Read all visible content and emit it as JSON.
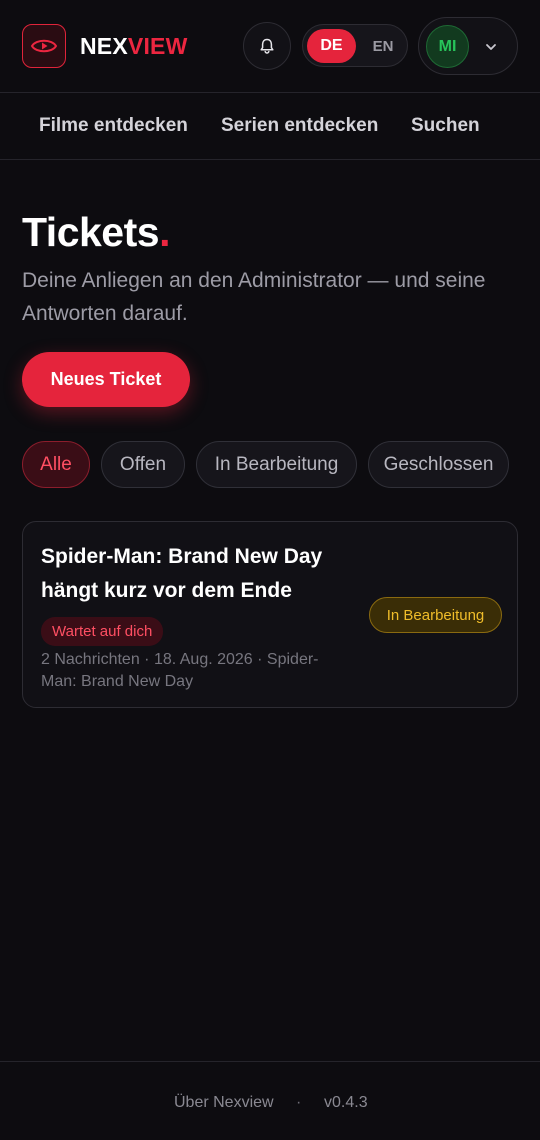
{
  "header": {
    "brand_part1": "NEX",
    "brand_part2": "VIEW",
    "logo_icon": "eye-play-icon",
    "notifications_icon": "bell-icon",
    "language": {
      "options": [
        "DE",
        "EN"
      ],
      "selected": "DE"
    },
    "user": {
      "initials": "MI",
      "menu_icon": "chevron-down-icon"
    }
  },
  "nav": {
    "items": [
      {
        "label": "Filme entdecken"
      },
      {
        "label": "Serien entdecken"
      },
      {
        "label": "Suchen"
      }
    ]
  },
  "main": {
    "title": "Tickets",
    "title_accent": ".",
    "subtitle": "Deine Anliegen an den Administrator — und seine Antworten darauf.",
    "new_ticket_label": "Neues Ticket",
    "filters": [
      {
        "label": "Alle",
        "active": true
      },
      {
        "label": "Offen",
        "active": false
      },
      {
        "label": "In Bearbeitung",
        "active": false
      },
      {
        "label": "Geschlossen",
        "active": false
      }
    ],
    "tickets": [
      {
        "title": "Spider-Man: Brand New Day hängt kurz vor dem Ende",
        "waiting_badge": "Wartet auf dich",
        "meta": "2 Nachrichten · 18. Aug. 2026 · Spider-Man: Brand New Day",
        "status": "In Bearbeitung"
      }
    ]
  },
  "footer": {
    "about_label": "Über Nexview",
    "separator": "·",
    "version": "v0.4.3"
  },
  "colors": {
    "background": "#0d0c10",
    "accent": "#e5243c",
    "status_in_progress": "#f0bd2a",
    "avatar_green": "#27c45a"
  }
}
